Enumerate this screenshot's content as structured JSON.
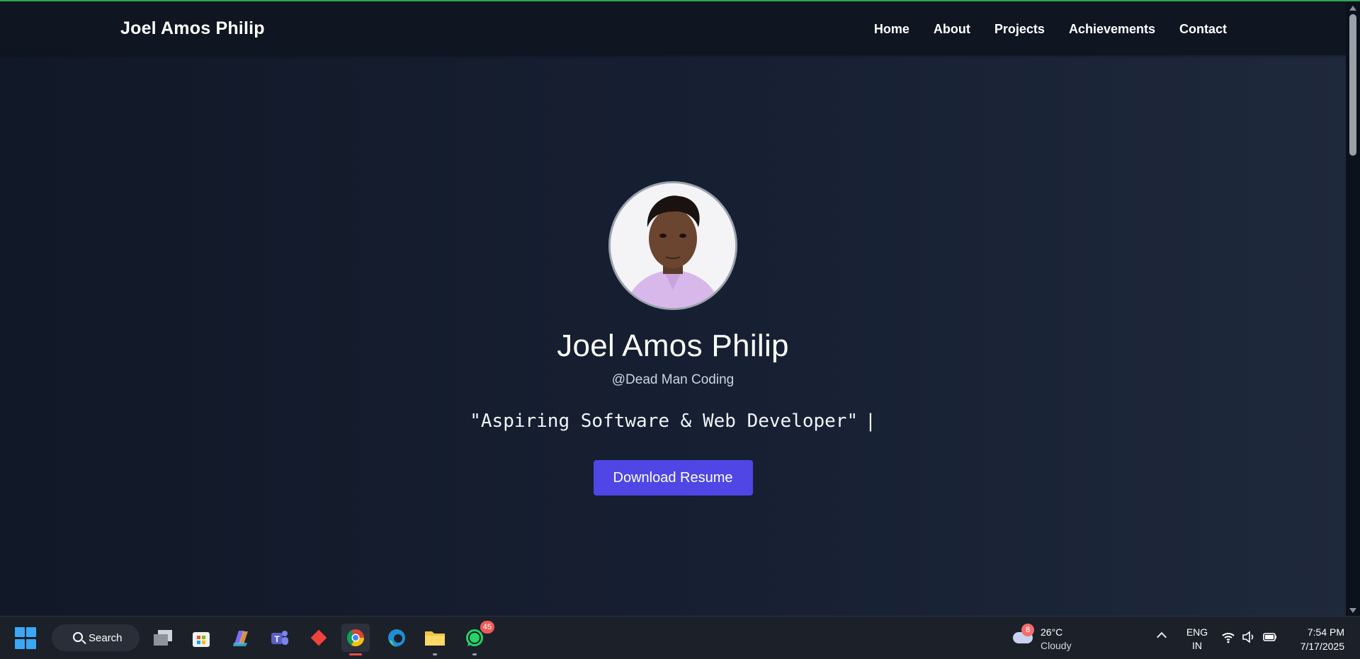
{
  "navbar": {
    "brand": "Joel Amos Philip",
    "links": [
      "Home",
      "About",
      "Projects",
      "Achievements",
      "Contact"
    ]
  },
  "hero": {
    "name": "Joel Amos Philip",
    "handle": "@Dead Man Coding",
    "tagline": "\"Aspiring Software & Web Developer\"",
    "caret": "|",
    "button_label": "Download Resume"
  },
  "taskbar": {
    "search_label": "Search",
    "apps": [
      {
        "name": "task-view-icon"
      },
      {
        "name": "microsoft-store-icon"
      },
      {
        "name": "copilot-icon"
      },
      {
        "name": "teams-icon"
      },
      {
        "name": "anydesk-icon"
      },
      {
        "name": "chrome-icon"
      },
      {
        "name": "edge-icon"
      },
      {
        "name": "file-explorer-icon"
      },
      {
        "name": "whatsapp-icon",
        "badge": "45"
      }
    ],
    "weather": {
      "badge": "8",
      "temp": "26°C",
      "condition": "Cloudy"
    },
    "language": {
      "line1": "ENG",
      "line2": "IN"
    },
    "clock": {
      "time": "7:54 PM",
      "date": "7/17/2025"
    }
  },
  "colors": {
    "accent": "#4f46e5",
    "background": "#111827",
    "navbar": "#0f1521"
  }
}
